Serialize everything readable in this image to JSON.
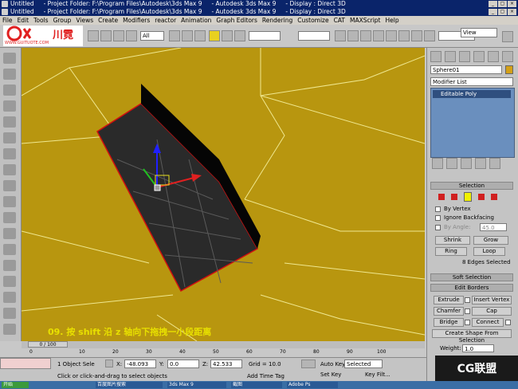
{
  "title_bars": [
    "Untitled     - Project Folder: F:\\Program Files\\Autodesk\\3ds Max 9     - Autodesk 3ds Max 9     - Display : Direct 3D",
    "Untitled     - Project Folder: F:\\Program Files\\Autodesk\\3ds Max 9     - Autodesk 3ds Max 9     - Display : Direct 3D"
  ],
  "window_controls": [
    "_",
    "▢",
    "×"
  ],
  "menu": [
    "File",
    "Edit",
    "Tools",
    "Group",
    "Views",
    "Create",
    "Modifiers",
    "reactor",
    "Animation",
    "Graph Editors",
    "Rendering",
    "Customize",
    "CAT",
    "MAXScript",
    "Help"
  ],
  "toolbar": {
    "selection_filter": "All",
    "ref_coord": "View",
    "ref_coord_right": "View",
    "watermark_text": "WWW.GUITUOTE.COM",
    "logo_text": "川霓"
  },
  "caption": "09. 按 shift 沿 z 轴向下拖拽一小段距离",
  "cmd_panel": {
    "object_name": "Sphere01",
    "color": "#d4a017",
    "modifier_list": "Modifier List",
    "stack_item": "Editable Poly",
    "selection_header": "Selection",
    "by_vertex": "By Vertex",
    "ignore_backfacing": "Ignore Backfacing",
    "by_angle": "By Angle:",
    "by_angle_value": "45.0",
    "shrink": "Shrink",
    "grow": "Grow",
    "ring": "Ring",
    "loop": "Loop",
    "selected_info": "8 Edges Selected",
    "soft_selection": "Soft Selection",
    "edit_borders": "Edit Borders",
    "extrude": "Extrude",
    "insert_vertex": "Insert Vertex",
    "chamfer": "Chamfer",
    "cap": "Cap",
    "bridge": "Bridge",
    "connect": "Connect",
    "create_shape": "Create Shape From Selection",
    "weight_label": "Weight:",
    "weight_value": "1.0"
  },
  "timeline": {
    "frame": "0 / 100",
    "ticks": [
      "0",
      "10",
      "20",
      "30",
      "40",
      "50",
      "60",
      "70",
      "80",
      "90",
      "100"
    ]
  },
  "status": {
    "selected": "1 Object Sele",
    "x_label": "X:",
    "x_value": "-48.093",
    "y_label": "Y:",
    "y_value": "0.0",
    "z_label": "Z:",
    "z_value": "42.533",
    "grid": "Grid = 10.0",
    "prompt": "Click or click-and-drag to select objects",
    "add_time_tag": "Add Time Tag",
    "auto_key": "Auto Key",
    "key_mode": "Selected",
    "set_key": "Set Key",
    "key_filters": "Key Filt..."
  },
  "brand_badge": "CG联盟",
  "taskbar_items": [
    "开始",
    "百度图片搜索",
    "3ds Max 9",
    "截图",
    "Adobe Ps"
  ],
  "colors": {
    "viewport_bg": "#b8960f",
    "mesh_dark": "#2a2a2a",
    "selection_red": "#e01010",
    "caption_yellow": "#e8e000"
  }
}
